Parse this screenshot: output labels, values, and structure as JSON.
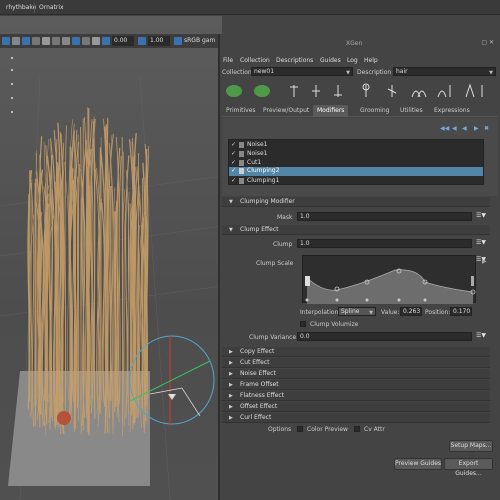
{
  "shelf": {
    "tabs": [
      "rhythbake",
      "Ornatrix"
    ]
  },
  "viewport": {
    "value_a": "0.00",
    "value_b": "1.00",
    "color_space": "sRGB gam"
  },
  "panel": {
    "title": "XGen",
    "menu": [
      "File",
      "Collection",
      "Descriptions",
      "Guides",
      "Log",
      "Help"
    ],
    "collection_label": "Collection",
    "collection_value": "new01",
    "description_label": "Description",
    "description_value": "hair",
    "tabs": [
      "Primitives",
      "Preview/Output",
      "Modifiers",
      "Grooming",
      "Utilities",
      "Expressions"
    ],
    "active_tab": "Modifiers",
    "modifiers": [
      "Noise1",
      "Noise1",
      "Cut1",
      "Clumping2",
      "Clumping1"
    ],
    "selected_modifier": "Clumping2"
  },
  "clumping": {
    "header": "Clumping Modifier",
    "mask_label": "Mask",
    "mask_value": "1.0",
    "clump_effect_header": "Clump Effect",
    "clump_label": "Clump",
    "clump_value": "1.0",
    "clump_scale_label": "Clump Scale",
    "interp_label": "Interpolation:",
    "interp_value": "Spline",
    "value_label": "Value:",
    "value_value": "0.263",
    "position_label": "Position:",
    "position_value": "0.170",
    "volumize_label": "Clump Volumize",
    "variance_label": "Clump Variance",
    "variance_value": "0.0"
  },
  "collapsed_sections": [
    "Copy Effect",
    "Cut Effect",
    "Noise Effect",
    "Frame Offset",
    "Flatness Effect",
    "Offset Effect",
    "Curl Effect"
  ],
  "options": {
    "label": "Options",
    "color_preview": "Color Preview",
    "cv_attr": "Cv Attr"
  },
  "buttons": {
    "setup_maps": "Setup Maps...",
    "preview_guides": "Preview Guides",
    "export_guides": "Export Guides..."
  },
  "colors": {
    "selected_row": "#5285a6",
    "hair": "#c9a06a",
    "panel_bg": "#444444"
  }
}
